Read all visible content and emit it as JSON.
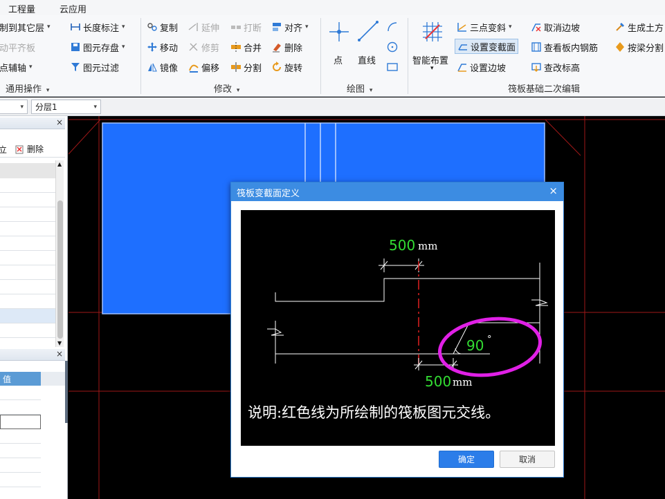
{
  "menubar": {
    "items": [
      "工程量",
      "云应用"
    ]
  },
  "ribbon": {
    "general": {
      "btn_copy_floor": "复制到其它层",
      "btn_auto_align": "自动平齐板",
      "btn_two_point_axis": "两点辅轴",
      "btn_length_mark": "长度标注",
      "btn_save_element": "图元存盘",
      "btn_filter": "图元过滤",
      "label": "通用操作"
    },
    "modify": {
      "btn_copy": "复制",
      "btn_move": "移动",
      "btn_mirror": "镜像",
      "btn_extend": "延伸",
      "btn_trim": "修剪",
      "btn_offset": "偏移",
      "btn_break": "打断",
      "btn_merge": "合并",
      "btn_split": "分割",
      "btn_align": "对齐",
      "btn_delete": "删除",
      "btn_rotate": "旋转",
      "label": "修改"
    },
    "draw": {
      "btn_point": "点",
      "btn_line": "直线",
      "label": "绘图"
    },
    "raft": {
      "btn_smart_layout": "智能布置",
      "btn_three_point_slope": "三点变斜",
      "btn_set_section": "设置变截面",
      "btn_set_edge_slope": "设置边坡",
      "btn_cancel_edge_slope": "取消边坡",
      "btn_view_rebar": "查看板内钢筋",
      "btn_change_elevation": "查改标高",
      "btn_generate_earthwork": "生成土方",
      "btn_beam_split": "按梁分割",
      "label": "筏板基础二次编辑"
    }
  },
  "toolbar2": {
    "floor_combo": "分层1"
  },
  "leftpanel": {
    "btn_delete": "删除",
    "col_value": "值"
  },
  "dialog": {
    "title": "筏板变截面定义",
    "dim_top_value": "500",
    "dim_top_unit": "mm",
    "dim_bottom_value": "500",
    "dim_bottom_unit": "mm",
    "angle_value": "90",
    "angle_unit": "°",
    "note": "说明:红色线为所绘制的筏板图元交线。",
    "ok": "确定",
    "cancel": "取消"
  },
  "colors": {
    "slab_fill": "#1e6fff",
    "highlight_circle": "#e020e6",
    "dimension_text": "#33dd33",
    "intersection_line": "#e02020",
    "dialog_header": "#3c8ce2"
  }
}
